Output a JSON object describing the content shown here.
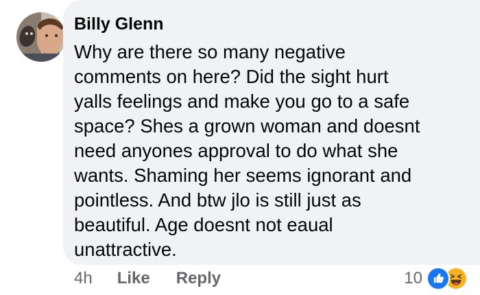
{
  "comment": {
    "author": "Billy Glenn",
    "text_lines": [
      "Why are there so many negative",
      "comments on here? Did the sight hurt",
      "yalls feelings and make you go to a safe",
      "space? Shes a grown woman and doesnt",
      "need anyones approval to do what she",
      "wants. Shaming her seems ignorant and",
      "pointless. And btw jlo is still just as",
      "beautiful. Age doesnt not eaual",
      "unattractive."
    ],
    "timestamp": "4h",
    "like_label": "Like",
    "reply_label": "Reply",
    "reaction_count": "10",
    "reaction_types": [
      "like-icon",
      "haha-icon"
    ]
  },
  "colors": {
    "bubble_bg": "#f0f2f5",
    "text": "#050505",
    "secondary_text": "#65676b",
    "like_blue": "#1877f2",
    "haha_yellow": "#f7b125"
  }
}
